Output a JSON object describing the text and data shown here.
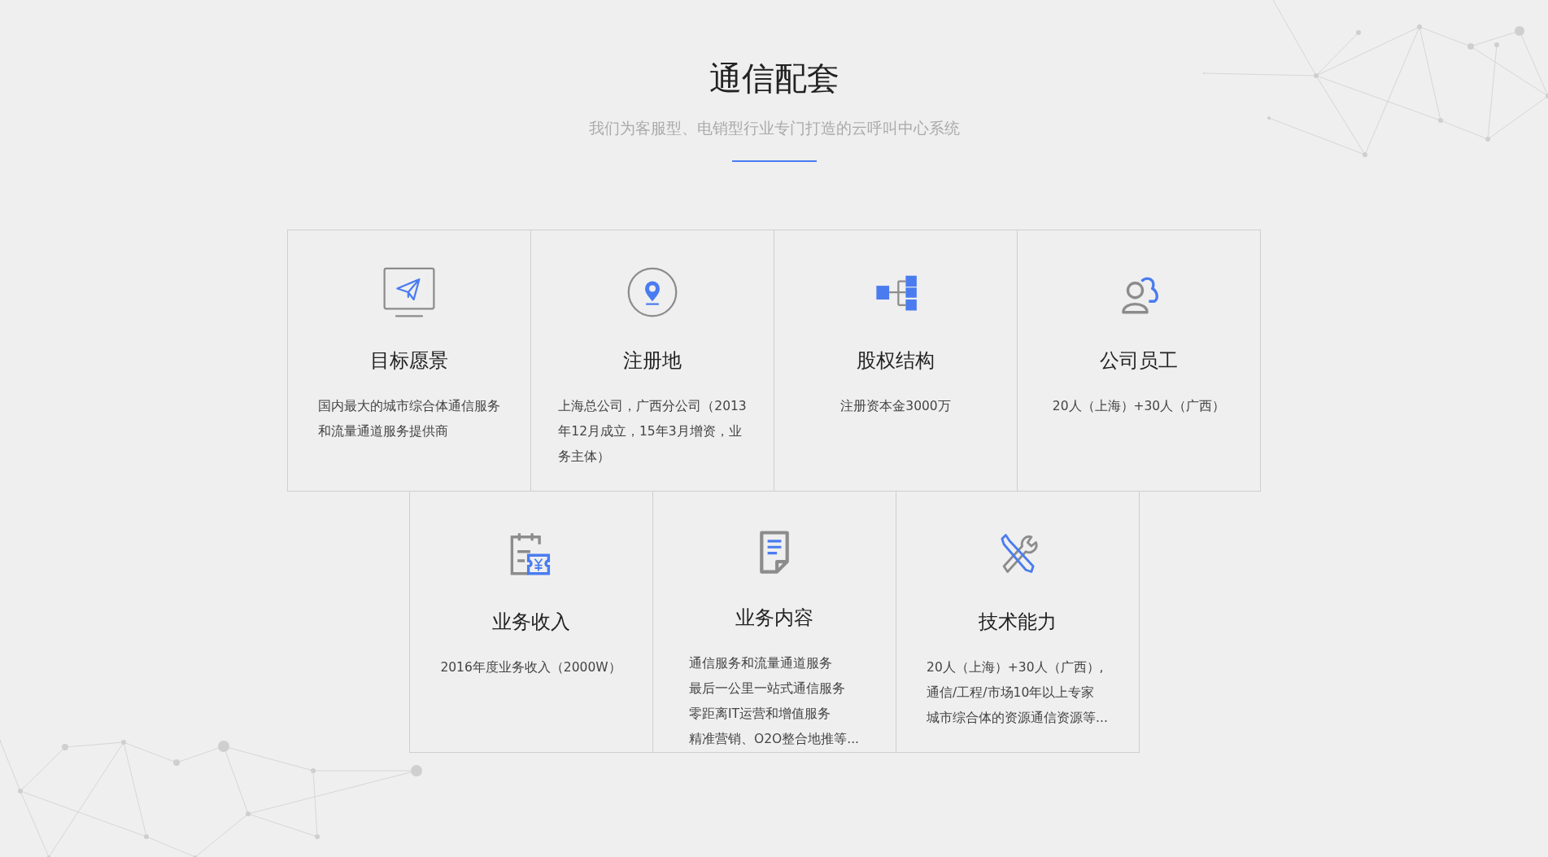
{
  "header": {
    "title": "通信配套",
    "subtitle": "我们为客服型、电销型行业专门打造的云呼叫中心系统"
  },
  "rows": [
    {
      "cards": [
        {
          "title": "目标愿景",
          "lines": [
            "国内最大的城市综合体通信服务",
            "和流量通道服务提供商"
          ]
        },
        {
          "title": "注册地",
          "lines": [
            "上海总公司，广西分公司（2013",
            "年12月成立，15年3月增资，业",
            "务主体）"
          ]
        },
        {
          "title": "股权结构",
          "lines": [
            "注册资本金3000万"
          ]
        },
        {
          "title": "公司员工",
          "lines": [
            "20人（上海）+30人（广西）"
          ]
        }
      ]
    },
    {
      "cards": [
        {
          "title": "业务收入",
          "lines": [
            "2016年度业务收入（2000W）"
          ]
        },
        {
          "title": "业务内容",
          "lines": [
            "通信服务和流量通道服务",
            "最后一公里一站式通信服务",
            "零距离IT运营和增值服务",
            "精准营销、O2O整合地推等..."
          ]
        },
        {
          "title": "技术能力",
          "lines": [
            "20人（上海）+30人（广西）,",
            "通信/工程/市场10年以上专家",
            "城市综合体的资源通信资源等..."
          ]
        }
      ]
    }
  ]
}
